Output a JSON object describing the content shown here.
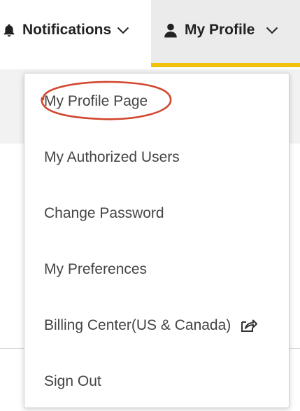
{
  "nav": {
    "notifications": {
      "label": "Notifications",
      "icon": "bell-icon"
    },
    "profile": {
      "label": "My Profile",
      "icon": "user-icon",
      "active_indicator_color": "#f2c10a"
    }
  },
  "dropdown": {
    "items": [
      {
        "label": "My Profile Page",
        "highlighted": true
      },
      {
        "label": "My Authorized Users"
      },
      {
        "label": "Change Password"
      },
      {
        "label": "My Preferences"
      },
      {
        "label": "Billing Center(US & Canada)",
        "icon": "external-share-icon"
      },
      {
        "label": "Sign Out"
      }
    ]
  },
  "colors": {
    "accent": "#f2c10a",
    "highlight_annotation": "#d2462e",
    "nav_active_bg": "#ebebeb",
    "text": "#444444"
  }
}
